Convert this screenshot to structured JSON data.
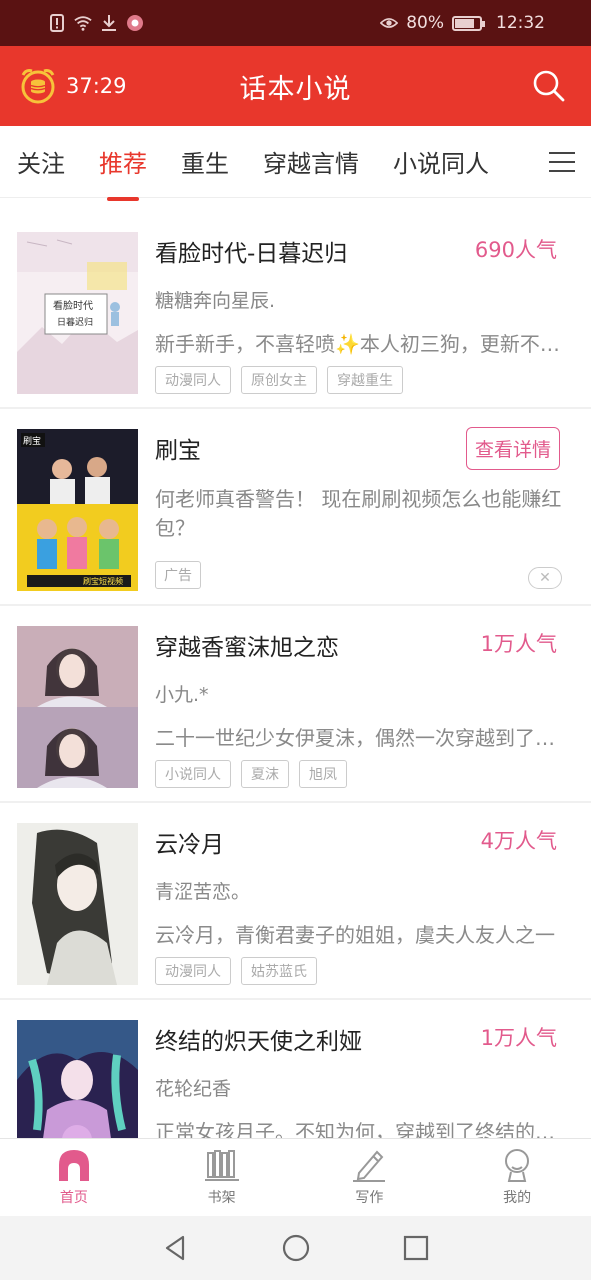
{
  "status_bar": {
    "battery": "80%",
    "time": "12:32",
    "battery_level": 0.8
  },
  "app_bar": {
    "timer": "37:29",
    "title": "话本小说"
  },
  "tabs": [
    {
      "label": "关注",
      "active": false
    },
    {
      "label": "推荐",
      "active": true
    },
    {
      "label": "重生",
      "active": false
    },
    {
      "label": "穿越言情",
      "active": false
    },
    {
      "label": "小说同人",
      "active": false
    }
  ],
  "books": [
    {
      "title": "看脸时代-日暮迟归",
      "popularity": "690人气",
      "author": "糖糖奔向星辰.",
      "description": "新手新手，不喜轻喷✨本人初三狗，更新不定时",
      "tags": [
        "动漫同人",
        "原创女主",
        "穿越重生"
      ],
      "cover_text": [
        "看脸时代",
        "日暮迟归"
      ]
    },
    {
      "is_ad": true,
      "title": "刷宝",
      "button": "查看详情",
      "description": "何老师真香警告！ 现在刷刷视频怎么也能赚红包？",
      "badge": "广告",
      "cover_text": [
        "刷宝",
        "刷宝短视频"
      ]
    },
    {
      "title": "穿越香蜜沫旭之恋",
      "popularity": "1万人气",
      "author": "小九.*",
      "description": "二十一世纪少女伊夏沫，偶然一次穿越到了香蜜",
      "tags": [
        "小说同人",
        "夏沫",
        "旭凤"
      ]
    },
    {
      "title": "云冷月",
      "popularity": "4万人气",
      "author": "青涩苦恋。",
      "description": "云冷月，青衡君妻子的姐姐，虞夫人友人之一",
      "tags": [
        "动漫同人",
        "姑苏蓝氏"
      ]
    },
    {
      "title": "终结的炽天使之利娅",
      "popularity": "1万人气",
      "author": "花轮纪香",
      "description": "正常女孩月子。不知为何，穿越到了终结的炽天使",
      "tags": []
    }
  ],
  "bottom_nav": [
    {
      "label": "首页",
      "icon": "home-icon",
      "active": true
    },
    {
      "label": "书架",
      "icon": "bookshelf-icon",
      "active": false
    },
    {
      "label": "写作",
      "icon": "pen-icon",
      "active": false
    },
    {
      "label": "我的",
      "icon": "profile-icon",
      "active": false
    }
  ],
  "colors": {
    "primary": "#e8372c",
    "accent_pink": "#e25a8c",
    "status_bar": "#5a1212"
  }
}
